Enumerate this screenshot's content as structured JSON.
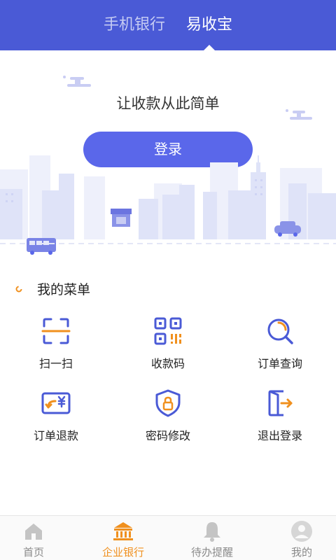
{
  "header": {
    "tabs": [
      {
        "label": "手机银行",
        "active": false
      },
      {
        "label": "易收宝",
        "active": true
      }
    ],
    "color": "#4a5ad6"
  },
  "hero": {
    "slogan": "让收款从此简单",
    "login_label": "登录",
    "button_color": "#5a67ea"
  },
  "menu": {
    "title": "我的菜单",
    "items": [
      {
        "label": "扫一扫",
        "icon": "scan-icon"
      },
      {
        "label": "收款码",
        "icon": "qr-code-icon"
      },
      {
        "label": "订单查询",
        "icon": "order-search-icon"
      },
      {
        "label": "订单退款",
        "icon": "refund-icon"
      },
      {
        "label": "密码修改",
        "icon": "password-shield-icon"
      },
      {
        "label": "退出登录",
        "icon": "logout-icon"
      }
    ]
  },
  "tabbar": {
    "items": [
      {
        "label": "首页",
        "icon": "home-icon",
        "active": false
      },
      {
        "label": "企业银行",
        "icon": "bank-icon",
        "active": true
      },
      {
        "label": "待办提醒",
        "icon": "bell-icon",
        "active": false
      },
      {
        "label": "我的",
        "icon": "user-avatar-icon",
        "active": false
      }
    ],
    "active_color": "#f0901e"
  }
}
